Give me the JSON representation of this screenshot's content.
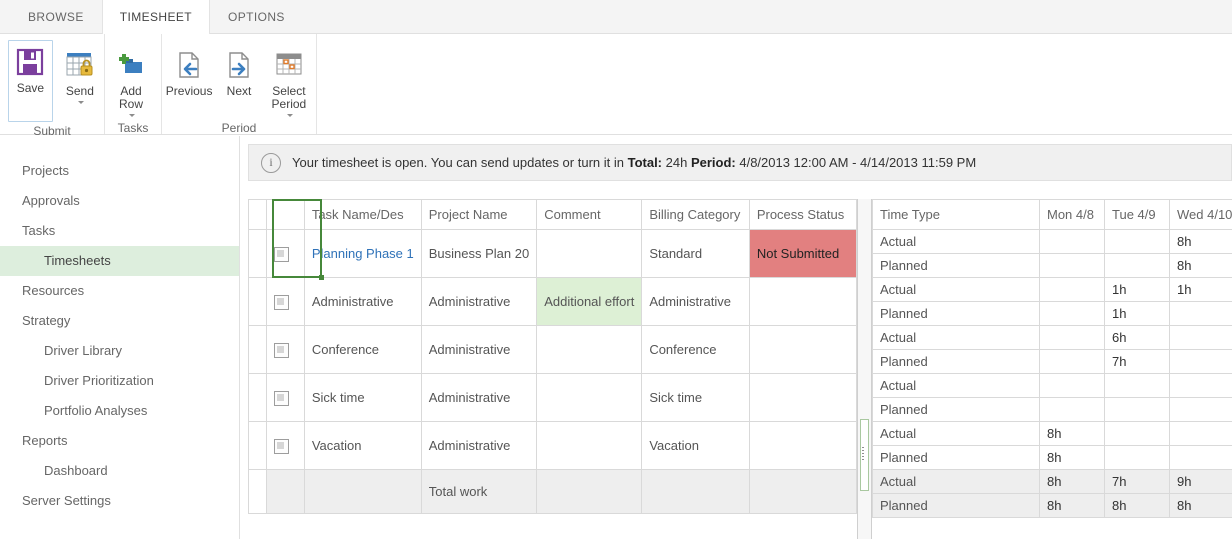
{
  "ribbon": {
    "tabs": [
      {
        "label": "BROWSE",
        "active": false
      },
      {
        "label": "TIMESHEET",
        "active": true
      },
      {
        "label": "OPTIONS",
        "active": false
      }
    ],
    "groups": [
      {
        "name": "Submit",
        "label": "Submit",
        "buttons": [
          {
            "label": "Save",
            "icon": "save-floppy-icon",
            "caret": false
          },
          {
            "label": "Send",
            "icon": "send-grid-lock-icon",
            "caret": true
          }
        ]
      },
      {
        "name": "Tasks",
        "label": "Tasks",
        "buttons": [
          {
            "label": "Add\nRow",
            "icon": "add-row-plus-icon",
            "caret": true
          }
        ]
      },
      {
        "name": "Period",
        "label": "Period",
        "buttons": [
          {
            "label": "Previous",
            "icon": "page-left-arrow-icon",
            "caret": false
          },
          {
            "label": "Next",
            "icon": "page-right-arrow-icon",
            "caret": false
          },
          {
            "label": "Select\nPeriod",
            "icon": "calendar-select-icon",
            "caret": true
          }
        ]
      }
    ]
  },
  "sidebar": {
    "items": [
      {
        "label": "Projects",
        "sub": false,
        "selected": false
      },
      {
        "label": "Approvals",
        "sub": false,
        "selected": false
      },
      {
        "label": "Tasks",
        "sub": false,
        "selected": false
      },
      {
        "label": "Timesheets",
        "sub": true,
        "selected": true
      },
      {
        "label": "Resources",
        "sub": false,
        "selected": false
      },
      {
        "label": "Strategy",
        "sub": false,
        "selected": false
      },
      {
        "label": "Driver Library",
        "sub": true,
        "selected": false
      },
      {
        "label": "Driver Prioritization",
        "sub": true,
        "selected": false
      },
      {
        "label": "Portfolio Analyses",
        "sub": true,
        "selected": false
      },
      {
        "label": "Reports",
        "sub": false,
        "selected": false
      },
      {
        "label": "Dashboard",
        "sub": true,
        "selected": false
      },
      {
        "label": "Server Settings",
        "sub": false,
        "selected": false
      }
    ]
  },
  "infobar": {
    "icon": "info-circle-icon",
    "text_plain": "Your timesheet is open. You can send updates or turn it in ",
    "total_label": "Total:",
    "total_value": " 24h ",
    "period_label": "Period:",
    "period_value": " 4/8/2013 12:00 AM - 4/14/2013 11:59 PM"
  },
  "grid": {
    "left_headers": [
      "",
      "Task Name/Des",
      "Project Name",
      "Comment",
      "Billing Category",
      "Process Status"
    ],
    "right_headers": [
      "Time Type",
      "Mon 4/8",
      "Tue 4/9",
      "Wed 4/10"
    ],
    "rows": [
      {
        "checkbox": true,
        "task": "Planning Phase 1",
        "task_is_link": true,
        "project": "Business Plan 20",
        "comment": "",
        "comment_highlight": false,
        "billing": "Standard",
        "status": "Not Submitted",
        "status_highlight": true,
        "actual": [
          "",
          "",
          "8h"
        ],
        "planned": [
          "",
          "",
          "8h"
        ]
      },
      {
        "checkbox": true,
        "task": "Administrative",
        "task_is_link": false,
        "project": "Administrative",
        "comment": "Additional effort",
        "comment_highlight": true,
        "billing": "Administrative",
        "status": "",
        "status_highlight": false,
        "actual": [
          "",
          "1h",
          "1h"
        ],
        "planned": [
          "",
          "1h",
          ""
        ]
      },
      {
        "checkbox": true,
        "task": "Conference",
        "task_is_link": false,
        "project": "Administrative",
        "comment": "",
        "comment_highlight": false,
        "billing": "Conference",
        "status": "",
        "status_highlight": false,
        "actual": [
          "",
          "6h",
          ""
        ],
        "planned": [
          "",
          "7h",
          ""
        ]
      },
      {
        "checkbox": true,
        "task": "Sick time",
        "task_is_link": false,
        "project": "Administrative",
        "comment": "",
        "comment_highlight": false,
        "billing": "Sick time",
        "status": "",
        "status_highlight": false,
        "actual": [
          "",
          "",
          ""
        ],
        "planned": [
          "",
          "",
          ""
        ]
      },
      {
        "checkbox": true,
        "task": "Vacation",
        "task_is_link": false,
        "project": "Administrative",
        "comment": "",
        "comment_highlight": false,
        "billing": "Vacation",
        "status": "",
        "status_highlight": false,
        "actual": [
          "8h",
          "",
          ""
        ],
        "planned": [
          "8h",
          "",
          ""
        ]
      }
    ],
    "total_row": {
      "task": "",
      "project": "Total work",
      "comment": "",
      "billing": "",
      "status": "",
      "actual": [
        "8h",
        "7h",
        "9h"
      ],
      "planned": [
        "8h",
        "8h",
        "8h"
      ]
    },
    "time_type_actual": "Actual",
    "time_type_planned": "Planned"
  }
}
